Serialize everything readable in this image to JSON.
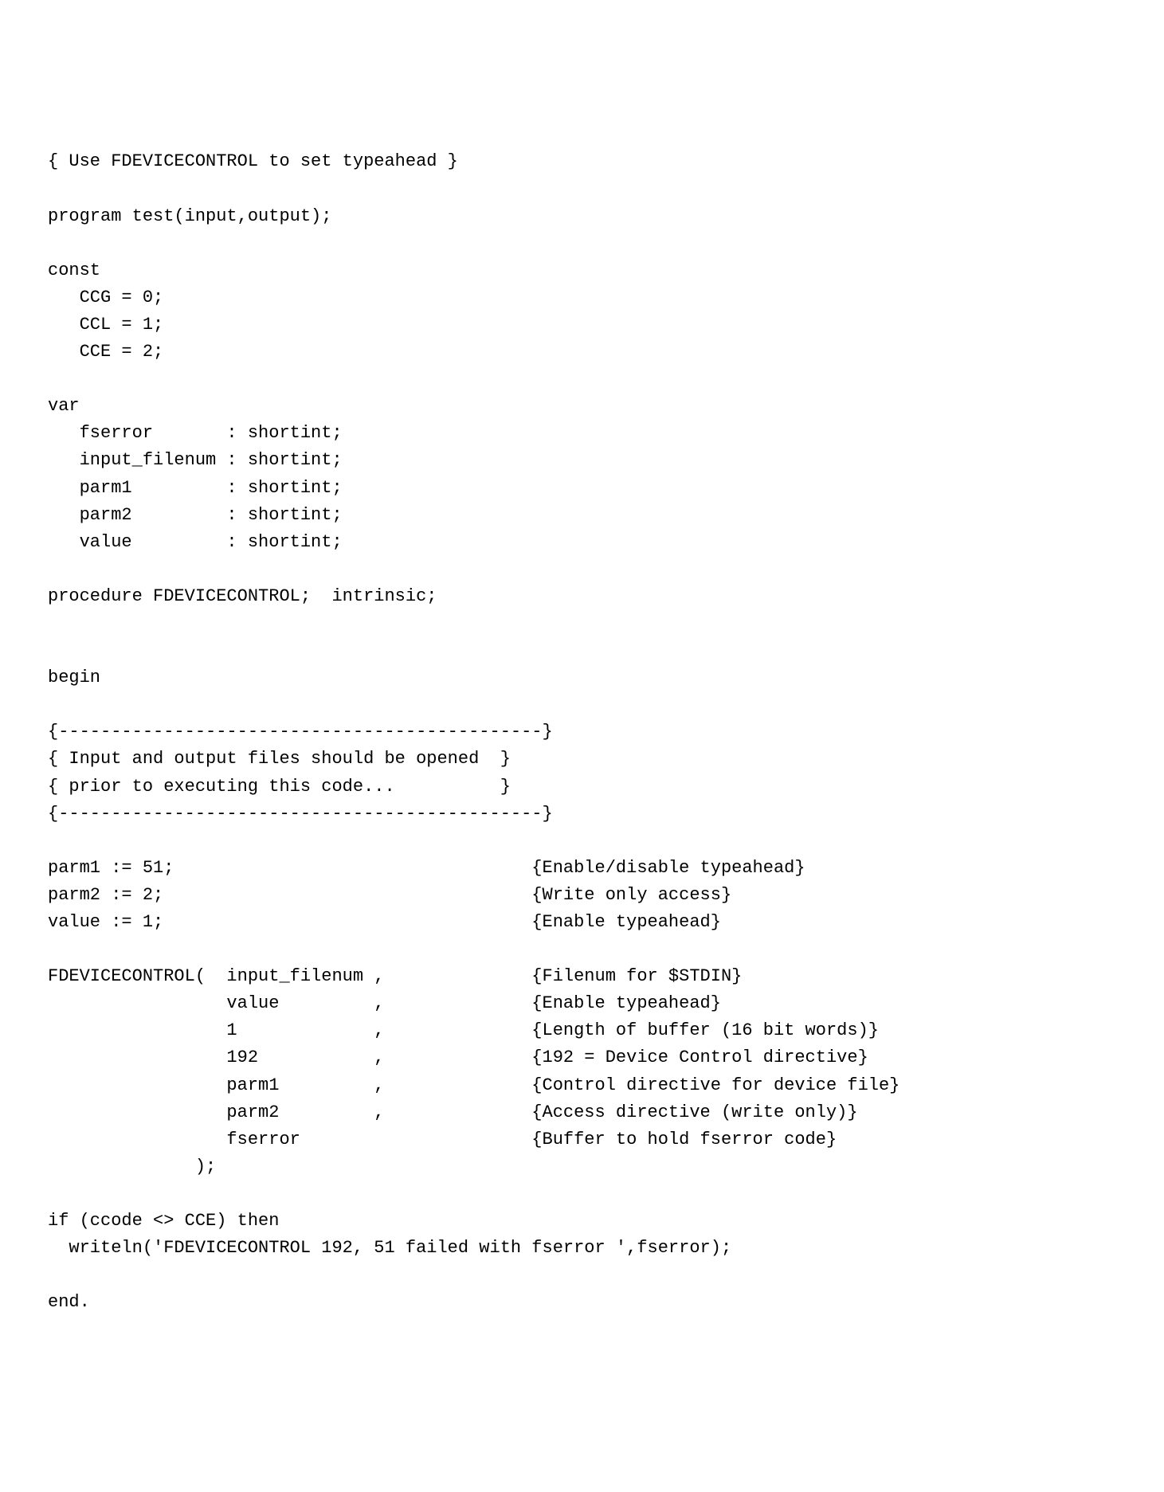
{
  "code": {
    "lines": [
      "{ Use FDEVICECONTROL to set typeahead }",
      "",
      "program test(input,output);",
      "",
      "const",
      "   CCG = 0;",
      "   CCL = 1;",
      "   CCE = 2;",
      "",
      "var",
      "   fserror       : shortint;",
      "   input_filenum : shortint;",
      "   parm1         : shortint;",
      "   parm2         : shortint;",
      "   value         : shortint;",
      "",
      "procedure FDEVICECONTROL;  intrinsic;",
      "",
      "",
      "begin",
      "",
      "{----------------------------------------------}",
      "{ Input and output files should be opened  }",
      "{ prior to executing this code...          }",
      "{----------------------------------------------}",
      "",
      "parm1 := 51;                                  {Enable/disable typeahead}",
      "parm2 := 2;                                   {Write only access}",
      "value := 1;                                   {Enable typeahead}",
      "",
      "FDEVICECONTROL(  input_filenum ,              {Filenum for $STDIN}",
      "                 value         ,              {Enable typeahead}",
      "                 1             ,              {Length of buffer (16 bit words)}",
      "                 192           ,              {192 = Device Control directive}",
      "                 parm1         ,              {Control directive for device file}",
      "                 parm2         ,              {Access directive (write only)}",
      "                 fserror                      {Buffer to hold fserror code}",
      "              );",
      "",
      "if (ccode <> CCE) then",
      "  writeln('FDEVICECONTROL 192, 51 failed with fserror ',fserror);",
      "",
      "end."
    ]
  }
}
